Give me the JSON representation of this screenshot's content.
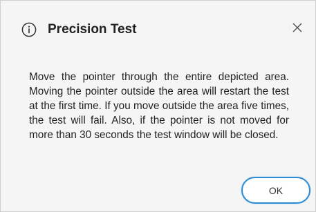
{
  "dialog": {
    "title": "Precision Test",
    "info_icon": "info-circle-icon",
    "close_icon": "close-x-icon",
    "message": "Move the pointer through the entire depicted area. Moving the pointer outside the area will restart the test at the first time. If you move outside the area five times, the test will fail. Also, if the pointer is not moved for more than 30 seconds the test window will be closed.",
    "ok_label": "OK",
    "accent_color": "#2b8cd3",
    "background_color": "#f5f5f5"
  }
}
